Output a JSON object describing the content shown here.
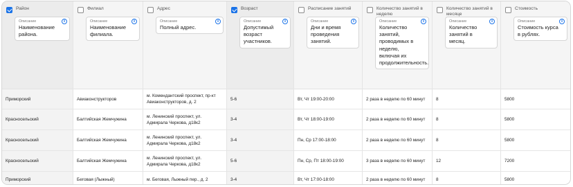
{
  "description_caption": "Описание",
  "columns": [
    {
      "key": "district",
      "title": "Район",
      "checked": true,
      "description": "Наименование района."
    },
    {
      "key": "branch",
      "title": "Филиал",
      "checked": false,
      "description": "Наименование филиала."
    },
    {
      "key": "address",
      "title": "Адрес",
      "checked": false,
      "description": "Полный адрес."
    },
    {
      "key": "age",
      "title": "Возраст",
      "checked": true,
      "description": "Допустимый возраст участников."
    },
    {
      "key": "schedule",
      "title": "Расписание занятий",
      "checked": false,
      "description": "Дни и время проведения занятий."
    },
    {
      "key": "per_week",
      "title": "Количество занятий в неделю",
      "checked": false,
      "description": "Количество занятий, проводимых в неделю, включая их продолжительность."
    },
    {
      "key": "per_month",
      "title": "Количество занятий в месяце",
      "checked": false,
      "description": "Количество занятий в месяц."
    },
    {
      "key": "price",
      "title": "Стоимость",
      "checked": false,
      "description": "Стоимость курса в рублях."
    }
  ],
  "rows": [
    [
      "Приморский",
      "Авиаконструкторов",
      "м. Комендантский проспект, пр-кт Авиаконструкторов, д. 2",
      "5-6",
      "Вт, Чт 19:00-20:00",
      "2 раза в неделю по 60 минут",
      "8",
      "5800"
    ],
    [
      "Красносельский",
      "Балтийская Жемчужина",
      "м. Ленинский проспект, ул. Адмирала Черкова, д18к2",
      "3-4",
      "Вт, Чт 18:00-19:00",
      "2 раза в неделю по 60 минут",
      "8",
      "5800"
    ],
    [
      "Красносельский",
      "Балтийская Жемчужина",
      "м. Ленинский проспект, ул. Адмирала Черкова, д18к2",
      "3-4",
      "Пн, Ср 17:00-18:00",
      "2 раза в неделю по 60 минут",
      "8",
      "5800"
    ],
    [
      "Красносельский",
      "Балтийская Жемчужина",
      "м. Ленинский проспект, ул. Адмирала Черкова, д18к2",
      "5-6",
      "Пн, Ср, Пт 18:00-19:00",
      "3 раза в неделю по 60 минут",
      "12",
      "7200"
    ],
    [
      "Приморский",
      "Беговая (Лыжный)",
      "м. Беговая, Лыжный пер., д. 2",
      "3-4",
      "Вт, Чт 17:00-18:00",
      "2 раза в неделю по 60 минут",
      "8",
      "5800"
    ]
  ],
  "icons": {
    "checkbox": "checkbox-icon",
    "info": "info-icon"
  },
  "colors": {
    "accent": "#1a73e8",
    "header_bg": "#f5f5f5",
    "border": "#e4e4e4"
  }
}
